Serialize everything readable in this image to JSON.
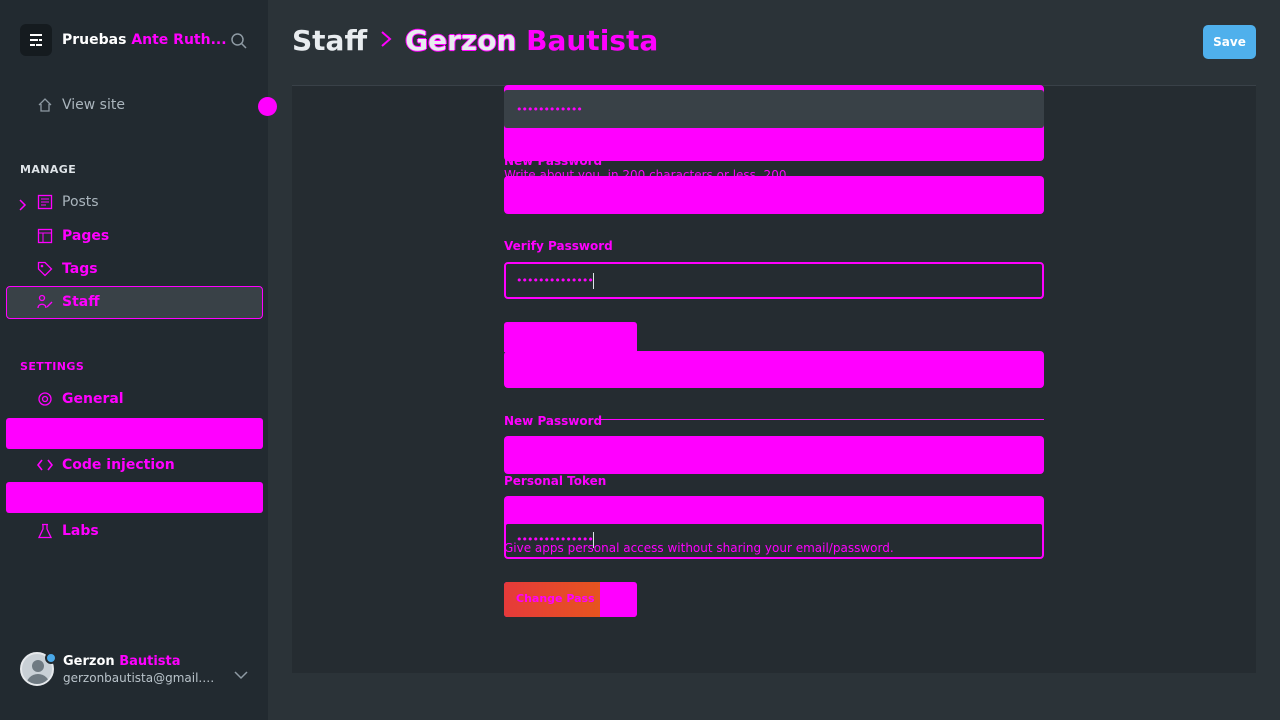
{
  "sidebar": {
    "brand_name": "Pruebas",
    "brand_name_suffix": "Ante Ruth...",
    "view_site": "View site",
    "manage_label": "MANAGE",
    "items": {
      "posts": "Posts",
      "pages": "Pages",
      "tags": "Tags",
      "staff": "Staff"
    },
    "settings_label": "SETTINGS",
    "settings_items": {
      "general": "General",
      "code_injection": "Code injection",
      "labs": "Labs"
    },
    "user": {
      "first_name": "Gerzon",
      "last_name": "Bautista",
      "email": "gerzonbautista@gmail.com"
    }
  },
  "header": {
    "crumb_root": "Staff",
    "crumb_first": "Gerzon",
    "crumb_last": "Bautista",
    "save": "Save"
  },
  "form": {
    "old_password_value": "••••••••••••",
    "new_password_label": "New Password",
    "bio_hint": "Write about you, in 200 characters or less. 200",
    "verify_password_label": "Verify Password",
    "verify_password_value": "••••••••••••••",
    "new_password_label_2": "New Password",
    "personal_token_label": "Personal Token",
    "token_value": "••••••••••••••",
    "token_hint": "Give apps personal access without sharing your email/password.",
    "change_button": "Change Pass"
  },
  "icons": {
    "brand": "ghost-menu-icon",
    "search": "search-icon",
    "home": "home-icon",
    "posts": "posts-icon",
    "pages": "pages-icon",
    "tags": "tag-icon",
    "staff": "staff-icon",
    "general": "gear-icon",
    "code": "code-icon",
    "labs": "flask-icon"
  },
  "colors": {
    "accent": "#ff00ff",
    "save": "#4fb0ec",
    "sidebar": "#222a30",
    "background": "#2b3338"
  }
}
